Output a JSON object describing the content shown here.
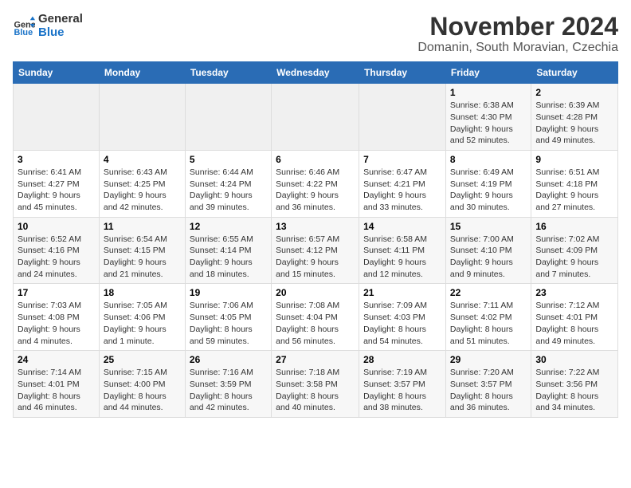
{
  "logo": {
    "text_general": "General",
    "text_blue": "Blue"
  },
  "header": {
    "month_year": "November 2024",
    "location": "Domanin, South Moravian, Czechia"
  },
  "weekdays": [
    "Sunday",
    "Monday",
    "Tuesday",
    "Wednesday",
    "Thursday",
    "Friday",
    "Saturday"
  ],
  "weeks": [
    [
      {
        "day": "",
        "detail": ""
      },
      {
        "day": "",
        "detail": ""
      },
      {
        "day": "",
        "detail": ""
      },
      {
        "day": "",
        "detail": ""
      },
      {
        "day": "",
        "detail": ""
      },
      {
        "day": "1",
        "detail": "Sunrise: 6:38 AM\nSunset: 4:30 PM\nDaylight: 9 hours\nand 52 minutes."
      },
      {
        "day": "2",
        "detail": "Sunrise: 6:39 AM\nSunset: 4:28 PM\nDaylight: 9 hours\nand 49 minutes."
      }
    ],
    [
      {
        "day": "3",
        "detail": "Sunrise: 6:41 AM\nSunset: 4:27 PM\nDaylight: 9 hours\nand 45 minutes."
      },
      {
        "day": "4",
        "detail": "Sunrise: 6:43 AM\nSunset: 4:25 PM\nDaylight: 9 hours\nand 42 minutes."
      },
      {
        "day": "5",
        "detail": "Sunrise: 6:44 AM\nSunset: 4:24 PM\nDaylight: 9 hours\nand 39 minutes."
      },
      {
        "day": "6",
        "detail": "Sunrise: 6:46 AM\nSunset: 4:22 PM\nDaylight: 9 hours\nand 36 minutes."
      },
      {
        "day": "7",
        "detail": "Sunrise: 6:47 AM\nSunset: 4:21 PM\nDaylight: 9 hours\nand 33 minutes."
      },
      {
        "day": "8",
        "detail": "Sunrise: 6:49 AM\nSunset: 4:19 PM\nDaylight: 9 hours\nand 30 minutes."
      },
      {
        "day": "9",
        "detail": "Sunrise: 6:51 AM\nSunset: 4:18 PM\nDaylight: 9 hours\nand 27 minutes."
      }
    ],
    [
      {
        "day": "10",
        "detail": "Sunrise: 6:52 AM\nSunset: 4:16 PM\nDaylight: 9 hours\nand 24 minutes."
      },
      {
        "day": "11",
        "detail": "Sunrise: 6:54 AM\nSunset: 4:15 PM\nDaylight: 9 hours\nand 21 minutes."
      },
      {
        "day": "12",
        "detail": "Sunrise: 6:55 AM\nSunset: 4:14 PM\nDaylight: 9 hours\nand 18 minutes."
      },
      {
        "day": "13",
        "detail": "Sunrise: 6:57 AM\nSunset: 4:12 PM\nDaylight: 9 hours\nand 15 minutes."
      },
      {
        "day": "14",
        "detail": "Sunrise: 6:58 AM\nSunset: 4:11 PM\nDaylight: 9 hours\nand 12 minutes."
      },
      {
        "day": "15",
        "detail": "Sunrise: 7:00 AM\nSunset: 4:10 PM\nDaylight: 9 hours\nand 9 minutes."
      },
      {
        "day": "16",
        "detail": "Sunrise: 7:02 AM\nSunset: 4:09 PM\nDaylight: 9 hours\nand 7 minutes."
      }
    ],
    [
      {
        "day": "17",
        "detail": "Sunrise: 7:03 AM\nSunset: 4:08 PM\nDaylight: 9 hours\nand 4 minutes."
      },
      {
        "day": "18",
        "detail": "Sunrise: 7:05 AM\nSunset: 4:06 PM\nDaylight: 9 hours\nand 1 minute."
      },
      {
        "day": "19",
        "detail": "Sunrise: 7:06 AM\nSunset: 4:05 PM\nDaylight: 8 hours\nand 59 minutes."
      },
      {
        "day": "20",
        "detail": "Sunrise: 7:08 AM\nSunset: 4:04 PM\nDaylight: 8 hours\nand 56 minutes."
      },
      {
        "day": "21",
        "detail": "Sunrise: 7:09 AM\nSunset: 4:03 PM\nDaylight: 8 hours\nand 54 minutes."
      },
      {
        "day": "22",
        "detail": "Sunrise: 7:11 AM\nSunset: 4:02 PM\nDaylight: 8 hours\nand 51 minutes."
      },
      {
        "day": "23",
        "detail": "Sunrise: 7:12 AM\nSunset: 4:01 PM\nDaylight: 8 hours\nand 49 minutes."
      }
    ],
    [
      {
        "day": "24",
        "detail": "Sunrise: 7:14 AM\nSunset: 4:01 PM\nDaylight: 8 hours\nand 46 minutes."
      },
      {
        "day": "25",
        "detail": "Sunrise: 7:15 AM\nSunset: 4:00 PM\nDaylight: 8 hours\nand 44 minutes."
      },
      {
        "day": "26",
        "detail": "Sunrise: 7:16 AM\nSunset: 3:59 PM\nDaylight: 8 hours\nand 42 minutes."
      },
      {
        "day": "27",
        "detail": "Sunrise: 7:18 AM\nSunset: 3:58 PM\nDaylight: 8 hours\nand 40 minutes."
      },
      {
        "day": "28",
        "detail": "Sunrise: 7:19 AM\nSunset: 3:57 PM\nDaylight: 8 hours\nand 38 minutes."
      },
      {
        "day": "29",
        "detail": "Sunrise: 7:20 AM\nSunset: 3:57 PM\nDaylight: 8 hours\nand 36 minutes."
      },
      {
        "day": "30",
        "detail": "Sunrise: 7:22 AM\nSunset: 3:56 PM\nDaylight: 8 hours\nand 34 minutes."
      }
    ]
  ]
}
